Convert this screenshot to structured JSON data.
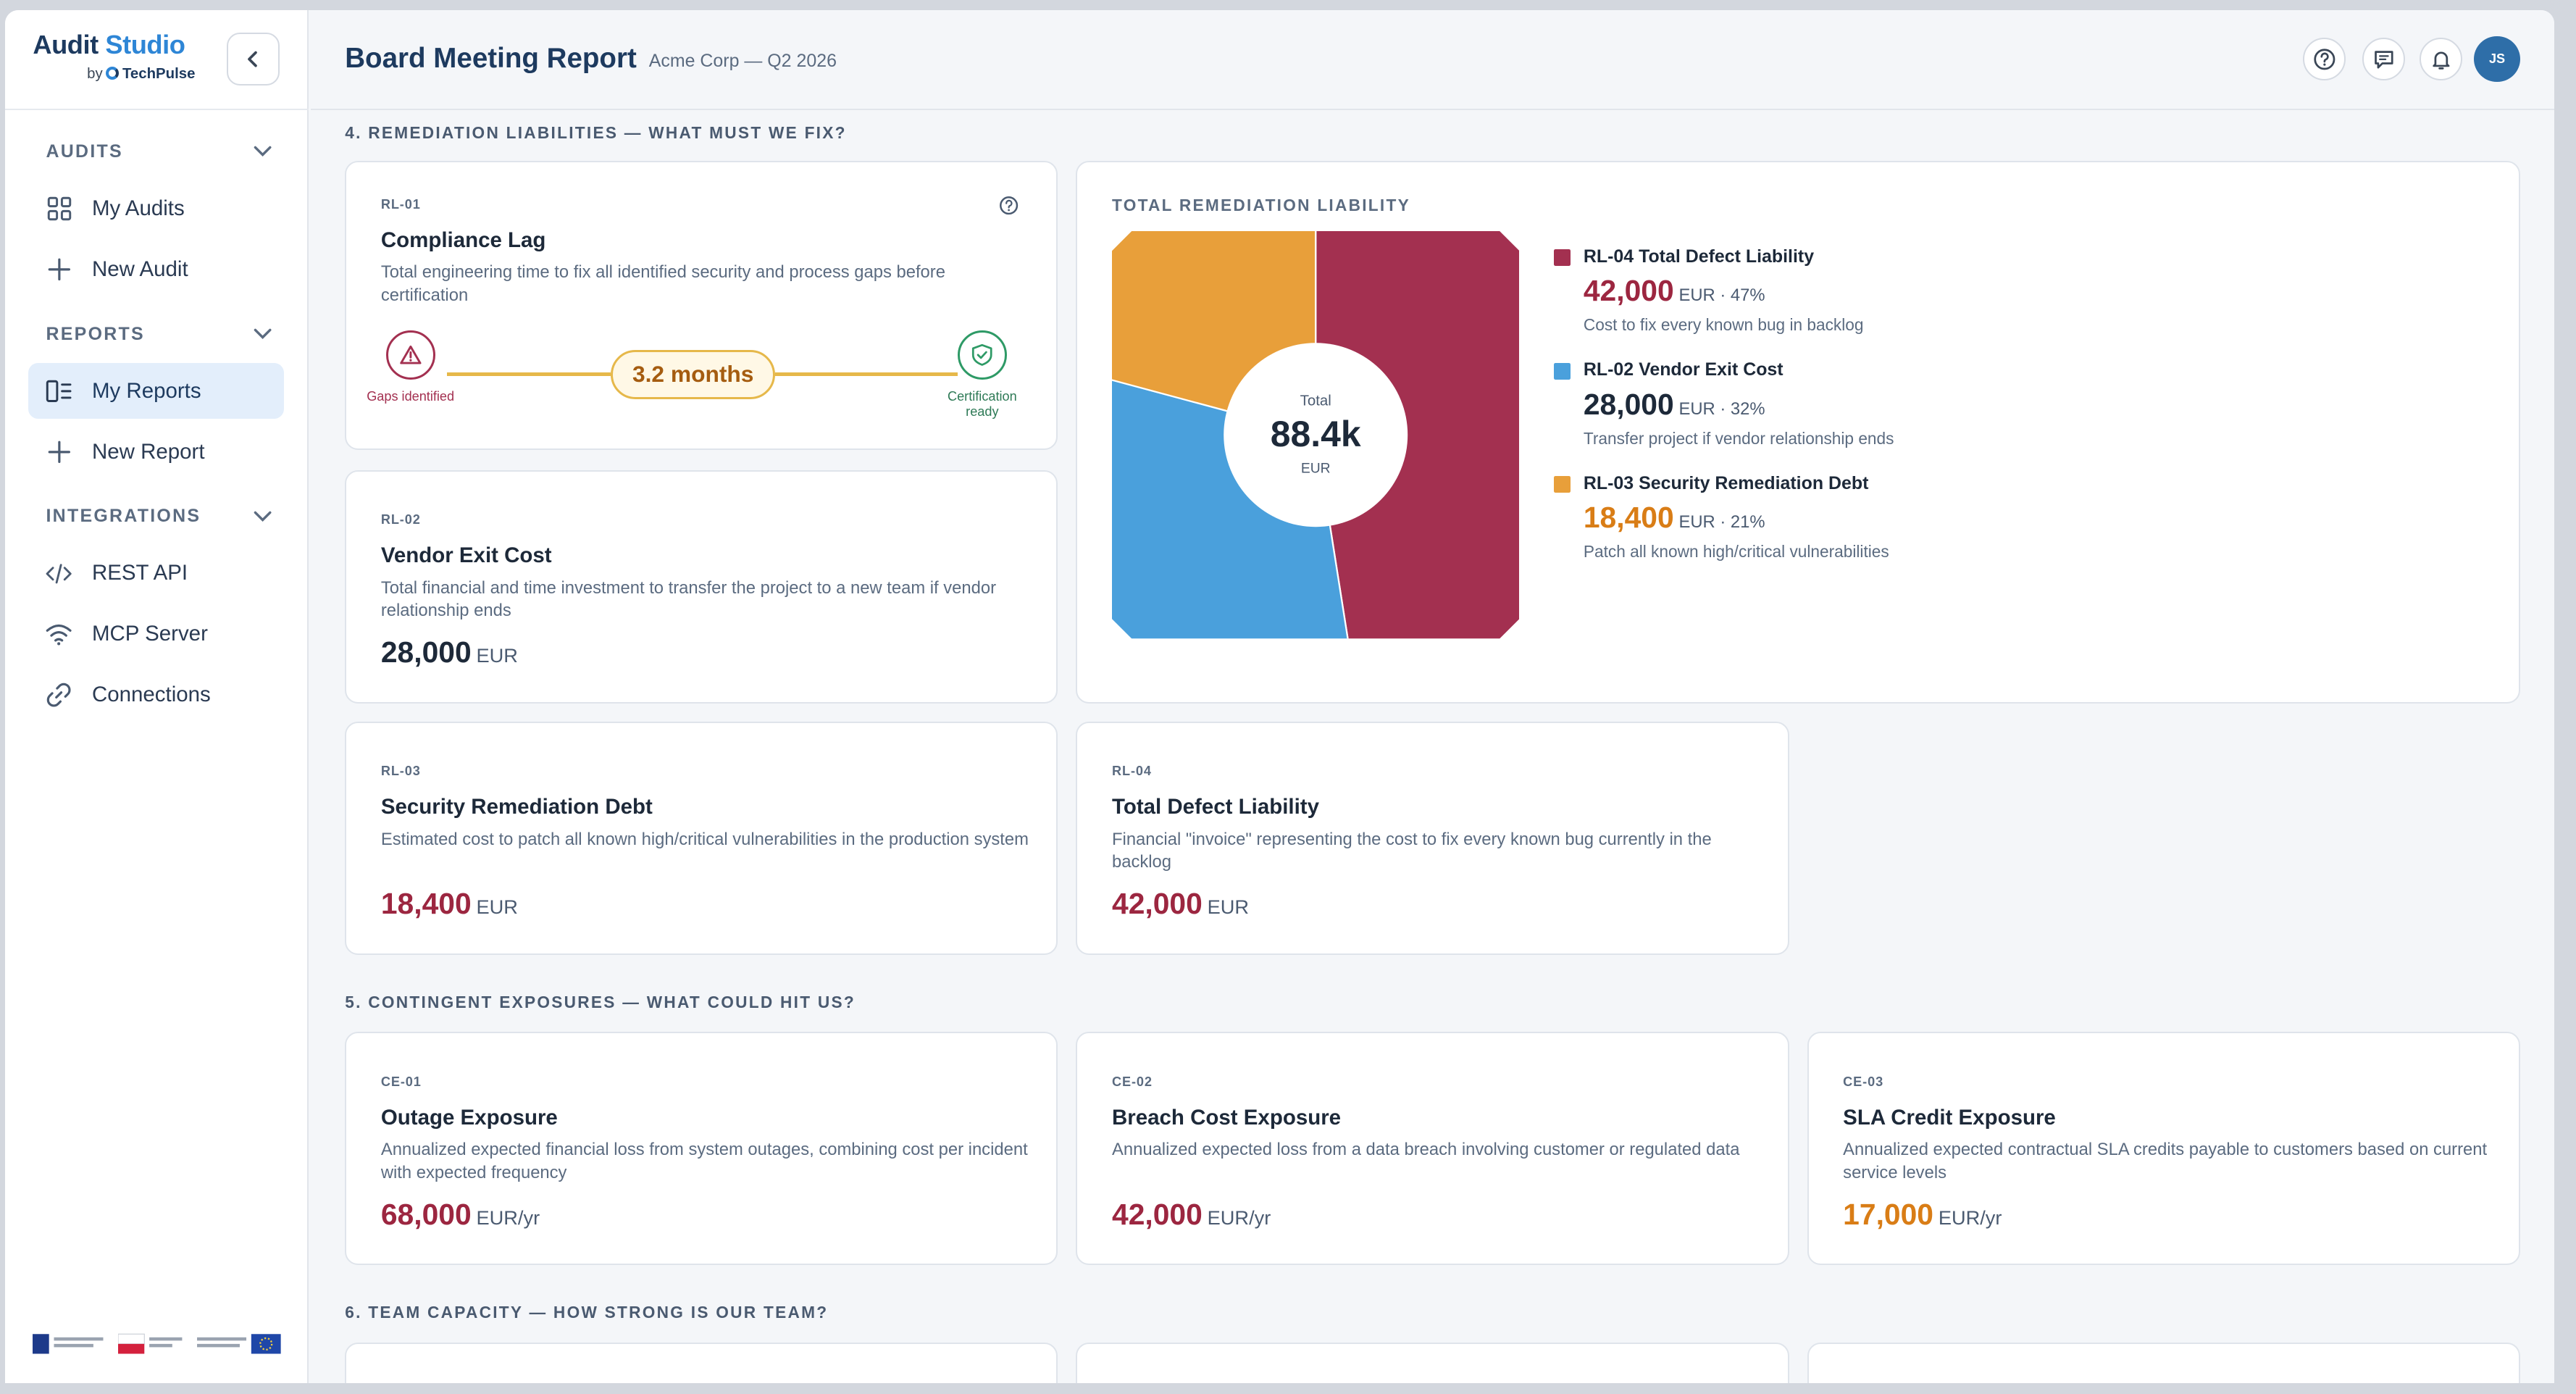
{
  "sidebar": {
    "brand_primary": "Audit",
    "brand_accent": "Studio",
    "brand_by": "by",
    "brand_company": "TechPulse",
    "sections": [
      {
        "title": "AUDITS",
        "items": [
          {
            "label": "My Audits",
            "icon": "grid-icon"
          },
          {
            "label": "New Audit",
            "icon": "plus-icon"
          }
        ]
      },
      {
        "title": "REPORTS",
        "items": [
          {
            "label": "My Reports",
            "icon": "report-icon",
            "active": true
          },
          {
            "label": "New Report",
            "icon": "plus-icon"
          }
        ]
      },
      {
        "title": "INTEGRATIONS",
        "items": [
          {
            "label": "REST API",
            "icon": "code-icon"
          },
          {
            "label": "MCP Server",
            "icon": "wifi-icon"
          },
          {
            "label": "Connections",
            "icon": "link-icon"
          }
        ]
      }
    ]
  },
  "header": {
    "title": "Board Meeting Report",
    "subtitle": "Acme Corp — Q2 2026",
    "avatar_initials": "JS"
  },
  "sections": {
    "s4": "4. REMEDIATION LIABILITIES — WHAT MUST WE FIX?",
    "s5": "5. CONTINGENT EXPOSURES — WHAT COULD HIT US?",
    "s6": "6. TEAM CAPACITY — HOW STRONG IS OUR TEAM?"
  },
  "rl01": {
    "code": "RL-01",
    "title": "Compliance Lag",
    "desc": "Total engineering time to fix all identified security and process gaps before certification",
    "value": "3.2 months",
    "start_label": "Gaps identified",
    "end_label": "Certification ready"
  },
  "rl02": {
    "code": "RL-02",
    "title": "Vendor Exit Cost",
    "desc": "Total financial and time investment to transfer the project to a new team if vendor relationship ends",
    "value": "28,000",
    "unit": "EUR"
  },
  "rl03": {
    "code": "RL-03",
    "title": "Security Remediation Debt",
    "desc": "Estimated cost to patch all known high/critical vulnerabilities in the production system",
    "value": "18,400",
    "unit": "EUR"
  },
  "rl04": {
    "code": "RL-04",
    "title": "Total Defect Liability",
    "desc": "Financial \"invoice\" representing the cost to fix every known bug currently in the backlog",
    "value": "42,000",
    "unit": "EUR"
  },
  "liability_chart": {
    "label": "TOTAL REMEDIATION LIABILITY",
    "center_caption": "Total",
    "center_value": "88.4k",
    "center_unit": "EUR",
    "legend": [
      {
        "title": "RL-04 Total Defect Liability",
        "value": "42,000",
        "meta": "EUR · 47%",
        "desc": "Cost to fix every known bug in backlog",
        "color": "#a33050"
      },
      {
        "title": "RL-02 Vendor Exit Cost",
        "value": "28,000",
        "meta": "EUR · 32%",
        "desc": "Transfer project if vendor relationship ends",
        "color": "#4aa0dc"
      },
      {
        "title": "RL-03 Security Remediation Debt",
        "value": "18,400",
        "meta": "EUR · 21%",
        "desc": "Patch all known high/critical vulnerabilities",
        "color": "#e89f3a"
      }
    ]
  },
  "chart_data": {
    "type": "pie",
    "categories": [
      "RL-04 Total Defect Liability",
      "RL-02 Vendor Exit Cost",
      "RL-03 Security Remediation Debt"
    ],
    "values": [
      42000,
      28000,
      18400
    ],
    "percent": [
      47,
      32,
      21
    ],
    "colors": [
      "#a33050",
      "#4aa0dc",
      "#e89f3a"
    ],
    "title": "TOTAL REMEDIATION LIABILITY"
  },
  "ce01": {
    "code": "CE-01",
    "title": "Outage Exposure",
    "desc": "Annualized expected financial loss from system outages, combining cost per incident with expected frequency",
    "value": "68,000",
    "unit": "EUR/yr"
  },
  "ce02": {
    "code": "CE-02",
    "title": "Breach Cost Exposure",
    "desc": "Annualized expected loss from a data breach involving customer or regulated data",
    "value": "42,000",
    "unit": "EUR/yr"
  },
  "ce03": {
    "code": "CE-03",
    "title": "SLA Credit Exposure",
    "desc": "Annualized expected contractual SLA credits payable to customers based on current service levels",
    "value": "17,000",
    "unit": "EUR/yr"
  }
}
